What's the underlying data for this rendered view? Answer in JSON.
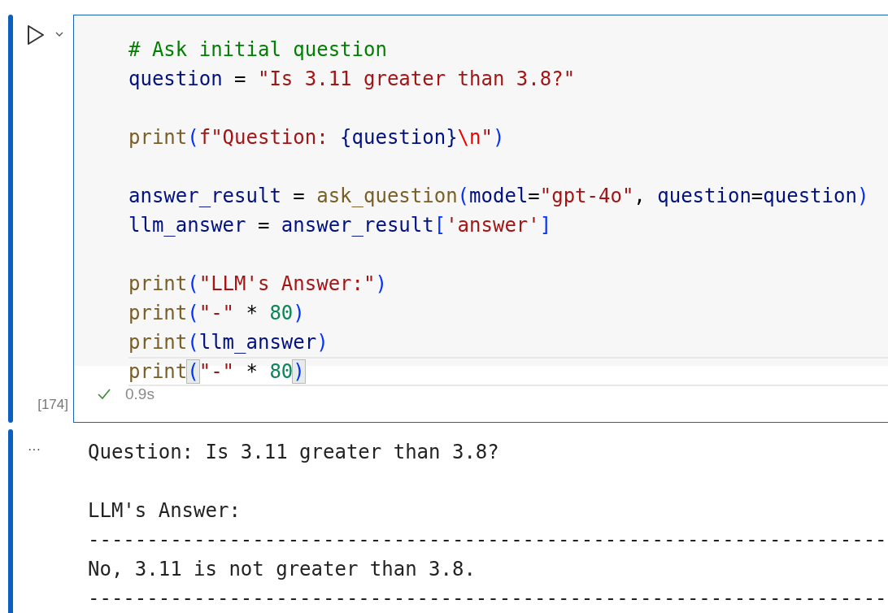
{
  "cell": {
    "execution_count": "[174]",
    "succeeded": true,
    "duration": "0.9s",
    "lines": [
      {
        "active": false,
        "tokens": [
          {
            "kind": "comment",
            "text": "# Ask initial question"
          }
        ]
      },
      {
        "active": false,
        "tokens": [
          {
            "kind": "variable",
            "text": "question"
          },
          {
            "kind": "plain",
            "text": " = "
          },
          {
            "kind": "string",
            "text": "\"Is 3.11 greater than 3.8?\""
          }
        ]
      },
      {
        "active": false
      },
      {
        "active": false,
        "tokens": [
          {
            "kind": "function",
            "text": "print"
          },
          {
            "kind": "paren",
            "text": "("
          },
          {
            "kind": "string",
            "text": "f\"Question: "
          },
          {
            "kind": "variable",
            "text": "{question}"
          },
          {
            "kind": "escape",
            "text": "\\n"
          },
          {
            "kind": "string",
            "text": "\""
          },
          {
            "kind": "paren",
            "text": ")"
          }
        ]
      },
      {
        "active": false
      },
      {
        "active": false,
        "tokens": [
          {
            "kind": "variable",
            "text": "answer_result"
          },
          {
            "kind": "plain",
            "text": " = "
          },
          {
            "kind": "function",
            "text": "ask_question"
          },
          {
            "kind": "paren",
            "text": "("
          },
          {
            "kind": "variable",
            "text": "model"
          },
          {
            "kind": "plain",
            "text": "="
          },
          {
            "kind": "string",
            "text": "\"gpt-4o\""
          },
          {
            "kind": "plain",
            "text": ", "
          },
          {
            "kind": "variable",
            "text": "question"
          },
          {
            "kind": "plain",
            "text": "="
          },
          {
            "kind": "variable",
            "text": "question"
          },
          {
            "kind": "paren",
            "text": ")"
          }
        ]
      },
      {
        "active": false,
        "tokens": [
          {
            "kind": "variable",
            "text": "llm_answer"
          },
          {
            "kind": "plain",
            "text": " = "
          },
          {
            "kind": "variable",
            "text": "answer_result"
          },
          {
            "kind": "paren",
            "text": "["
          },
          {
            "kind": "string",
            "text": "'answer'"
          },
          {
            "kind": "paren",
            "text": "]"
          }
        ]
      },
      {
        "active": false
      },
      {
        "active": false,
        "tokens": [
          {
            "kind": "function",
            "text": "print"
          },
          {
            "kind": "paren",
            "text": "("
          },
          {
            "kind": "string",
            "text": "\"LLM's Answer:\""
          },
          {
            "kind": "paren",
            "text": ")"
          }
        ]
      },
      {
        "active": false,
        "tokens": [
          {
            "kind": "function",
            "text": "print"
          },
          {
            "kind": "paren",
            "text": "("
          },
          {
            "kind": "string",
            "text": "\"-\""
          },
          {
            "kind": "plain",
            "text": " * "
          },
          {
            "kind": "number",
            "text": "80"
          },
          {
            "kind": "paren",
            "text": ")"
          }
        ]
      },
      {
        "active": false,
        "tokens": [
          {
            "kind": "function",
            "text": "print"
          },
          {
            "kind": "paren",
            "text": "("
          },
          {
            "kind": "variable",
            "text": "llm_answer"
          },
          {
            "kind": "paren",
            "text": ")"
          }
        ]
      },
      {
        "active": true,
        "tokens": [
          {
            "kind": "function",
            "text": "print"
          },
          {
            "kind": "bracket",
            "text": "("
          },
          {
            "kind": "string",
            "text": "\"-\""
          },
          {
            "kind": "plain",
            "text": " * "
          },
          {
            "kind": "number",
            "text": "80"
          },
          {
            "kind": "bracket",
            "text": ")"
          }
        ]
      }
    ]
  },
  "output": {
    "marker": "···",
    "blocks": [
      [
        "Question: Is 3.11 greater than 3.8?"
      ],
      [
        "LLM's Answer:",
        "--------------------------------------------------------------------",
        "No, 3.11 is not greater than 3.8.",
        "--------------------------------------------------------------------"
      ]
    ]
  }
}
